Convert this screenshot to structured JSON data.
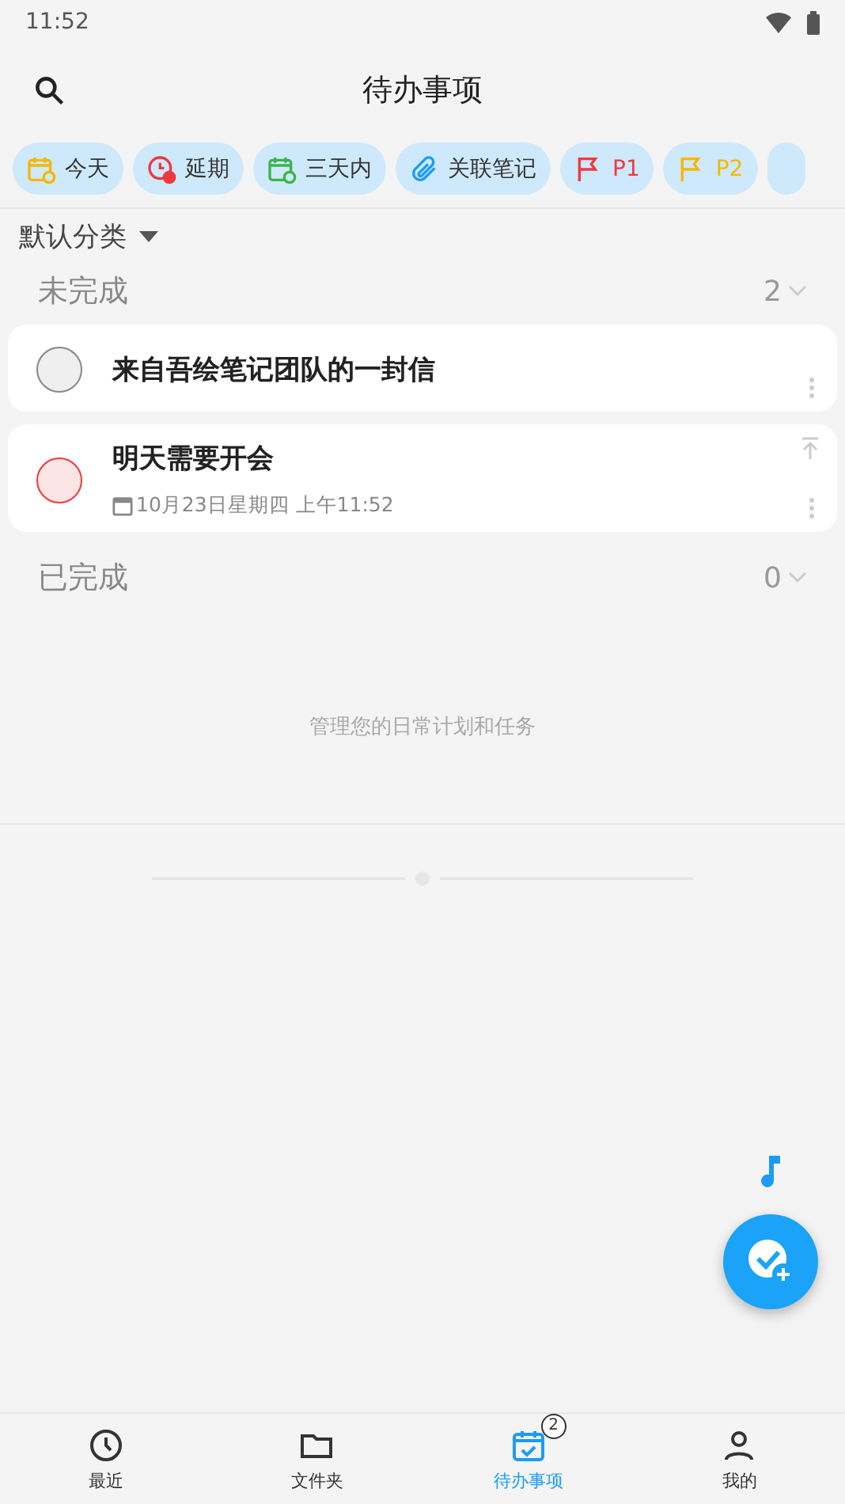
{
  "status_bar": {
    "time": "11:52"
  },
  "header": {
    "title": "待办事项"
  },
  "filters": [
    {
      "label": "今天",
      "kind": "today",
      "color": "#333333"
    },
    {
      "label": "延期",
      "kind": "overdue",
      "color": "#333333"
    },
    {
      "label": "三天内",
      "kind": "three-days",
      "color": "#333333"
    },
    {
      "label": "关联笔记",
      "kind": "linked",
      "color": "#333333"
    },
    {
      "label": "P1",
      "kind": "flag",
      "color": "#f0393f"
    },
    {
      "label": "P2",
      "kind": "flag",
      "color": "#f5b700"
    }
  ],
  "category": {
    "label": "默认分类"
  },
  "sections": [
    {
      "title": "未完成",
      "count": "2",
      "tasks": [
        {
          "title": "来自吾绘笔记团队的一封信",
          "color": "#888888",
          "pinned": false
        },
        {
          "title": "明天需要开会",
          "color": "#f0393f",
          "pinned": true,
          "due": "10月23日星期四 上午11:52"
        }
      ]
    },
    {
      "title": "已完成",
      "count": "0"
    }
  ],
  "empty_hint": "管理您的日常计划和任务",
  "tabs": [
    {
      "label": "最近",
      "kind": "clock",
      "selected": false
    },
    {
      "label": "文件夹",
      "kind": "folder",
      "selected": false
    },
    {
      "label": "待办事项",
      "kind": "todo",
      "selected": true,
      "badge": "2"
    },
    {
      "label": "我的",
      "kind": "person",
      "selected": false
    }
  ]
}
